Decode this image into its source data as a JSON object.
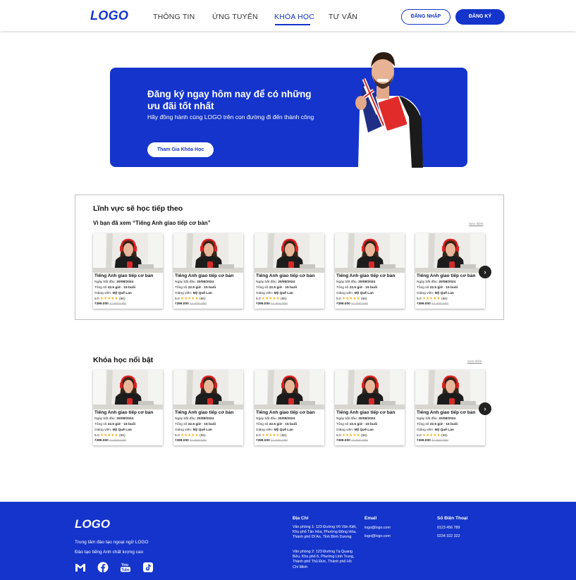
{
  "header": {
    "logo": "LOGO",
    "nav": [
      "THÔNG TIN",
      "ỨNG TUYỂN",
      "KHÓA HỌC",
      "TƯ VẤN"
    ],
    "active_nav": "KHÓA HỌC",
    "login": "ĐĂNG NHẬP",
    "signup": "ĐĂNG KÝ"
  },
  "banner": {
    "title": "Đăng ký ngay hôm nay để có những ưu đãi tốt nhất",
    "subtitle": "Hãy đồng hành cùng LOGO trên con đường đi đến thành công",
    "cta": "Tham Gia Khóa Học"
  },
  "recommend": {
    "title": "Lĩnh vực sẽ học tiếp theo",
    "subtitle": "Vì bạn đã xem “Tiếng Anh giao tiếp cơ bản”",
    "see_more": "Xem thêm"
  },
  "featured": {
    "title": "Khóa học nổi bật",
    "see_more": "Xem thêm"
  },
  "course_card": {
    "title": "Tiếng Anh giao tiếp cơ bản",
    "start_label": "Ngày bắt đầu:",
    "start_date": "20/08/2024",
    "total_label": "Tổng số",
    "total_value": "22.5 giờ · 15 buổi",
    "teacher_label": "Giảng viên:",
    "teacher": "Mỹ Quế Lan",
    "rating": "5.0",
    "stars": "★★★★★",
    "reviews": "(66)",
    "price": "₫399.000",
    "old_price": "₫1.000.000"
  },
  "footer": {
    "logo": "LOGO",
    "tagline1": "Trung tâm đào tạo ngoại ngữ LOGO",
    "tagline2": "Đào tạo tiếng Anh chất lượng cao",
    "address_h": "Địa Chỉ",
    "address1": "Văn phòng 1: 123 Đường Võ Văn Kiệt, Khu phố Tân Hòa, Phường Đông Hòa, Thành phố Dĩ An, Tỉnh  Bình Dương",
    "address2": "Văn phòng 2: 123 Đường Tạ Quang Bửu, Khu phố 6, Phường Linh Trung, Thành phố Thủ Đức, Thành phố Hồ Chí Minh",
    "email_h": "Email",
    "email1": "logo@logo.com",
    "email2": "logo@logo.com",
    "phone_h": "Số Điện Thoại",
    "phone1": "0123 456 789",
    "phone2": "0234 322 322",
    "social": [
      "gmail-icon",
      "facebook-icon",
      "youtube-icon",
      "tiktok-icon"
    ]
  },
  "colors": {
    "brand": "#1434cb",
    "star": "#f2b01e"
  }
}
